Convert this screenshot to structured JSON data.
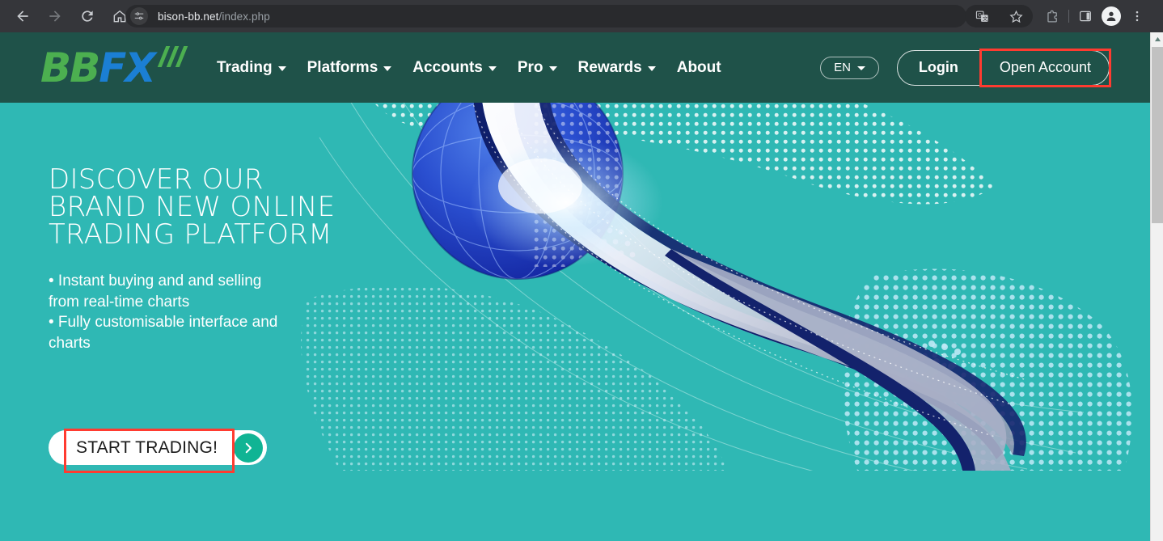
{
  "browser": {
    "back_icon": "back-arrow-icon",
    "forward_icon": "forward-arrow-icon",
    "reload_icon": "reload-icon",
    "home_icon": "home-icon",
    "site_settings_icon": "tune-icon",
    "url_domain": "bison-bb.net",
    "url_path": "/index.php",
    "url_full": "bison-bb.net/index.php",
    "translate_icon": "translate-icon",
    "bookmark_icon": "star-icon",
    "extensions_icon": "extensions-puzzle-icon",
    "side_panel_icon": "side-panel-icon",
    "profile_icon": "profile-avatar-icon",
    "menu_icon": "three-dot-menu-icon"
  },
  "site": {
    "logo": {
      "part1": "BB",
      "part2": "FX",
      "accent_green": "#4caf50",
      "accent_blue": "#1b7fd4"
    },
    "nav": [
      {
        "label": "Trading",
        "has_caret": true
      },
      {
        "label": "Platforms",
        "has_caret": true
      },
      {
        "label": "Accounts",
        "has_caret": true
      },
      {
        "label": "Pro",
        "has_caret": true
      },
      {
        "label": "Rewards",
        "has_caret": true
      },
      {
        "label": "About",
        "has_caret": false
      }
    ],
    "language": {
      "label": "EN"
    },
    "auth": {
      "login_label": "Login",
      "open_account_label": "Open Account",
      "highlight_color": "#ff3b30"
    },
    "header_bg": "#1f5249"
  },
  "hero": {
    "title": "DISCOVER OUR BRAND NEW ONLINE TRADING PLATFORM",
    "bullets": [
      "• Instant buying and and selling from real-time charts",
      "• Fully customisable interface and charts"
    ],
    "cta": {
      "label": "START TRADING!",
      "arrow_icon": "chevron-right-icon",
      "arrow_bg": "#10b494",
      "highlight_color": "#ff3b30"
    },
    "background_color": "#2fb8b4",
    "artwork": "blue-globe-with-silver-swoosh-and-dotted-world-map"
  },
  "scrollbar": {
    "up_arrow_icon": "scroll-up-arrow-icon",
    "thumb_label": "vertical-scroll-thumb"
  }
}
